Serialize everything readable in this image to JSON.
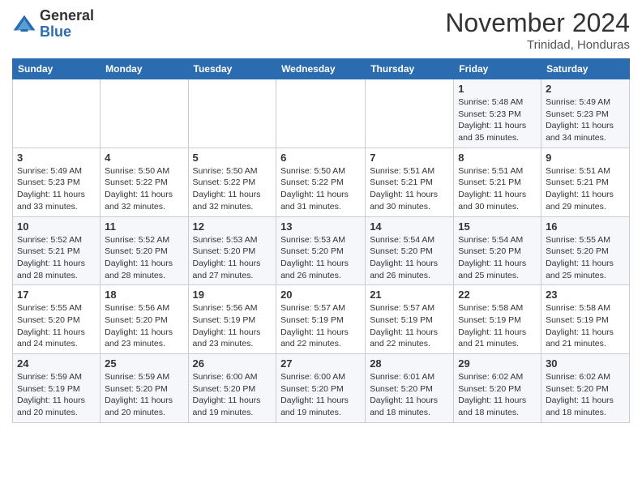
{
  "header": {
    "logo_general": "General",
    "logo_blue": "Blue",
    "month": "November 2024",
    "location": "Trinidad, Honduras"
  },
  "weekdays": [
    "Sunday",
    "Monday",
    "Tuesday",
    "Wednesday",
    "Thursday",
    "Friday",
    "Saturday"
  ],
  "weeks": [
    [
      {
        "day": "",
        "info": ""
      },
      {
        "day": "",
        "info": ""
      },
      {
        "day": "",
        "info": ""
      },
      {
        "day": "",
        "info": ""
      },
      {
        "day": "",
        "info": ""
      },
      {
        "day": "1",
        "info": "Sunrise: 5:48 AM\nSunset: 5:23 PM\nDaylight: 11 hours\nand 35 minutes."
      },
      {
        "day": "2",
        "info": "Sunrise: 5:49 AM\nSunset: 5:23 PM\nDaylight: 11 hours\nand 34 minutes."
      }
    ],
    [
      {
        "day": "3",
        "info": "Sunrise: 5:49 AM\nSunset: 5:23 PM\nDaylight: 11 hours\nand 33 minutes."
      },
      {
        "day": "4",
        "info": "Sunrise: 5:50 AM\nSunset: 5:22 PM\nDaylight: 11 hours\nand 32 minutes."
      },
      {
        "day": "5",
        "info": "Sunrise: 5:50 AM\nSunset: 5:22 PM\nDaylight: 11 hours\nand 32 minutes."
      },
      {
        "day": "6",
        "info": "Sunrise: 5:50 AM\nSunset: 5:22 PM\nDaylight: 11 hours\nand 31 minutes."
      },
      {
        "day": "7",
        "info": "Sunrise: 5:51 AM\nSunset: 5:21 PM\nDaylight: 11 hours\nand 30 minutes."
      },
      {
        "day": "8",
        "info": "Sunrise: 5:51 AM\nSunset: 5:21 PM\nDaylight: 11 hours\nand 30 minutes."
      },
      {
        "day": "9",
        "info": "Sunrise: 5:51 AM\nSunset: 5:21 PM\nDaylight: 11 hours\nand 29 minutes."
      }
    ],
    [
      {
        "day": "10",
        "info": "Sunrise: 5:52 AM\nSunset: 5:21 PM\nDaylight: 11 hours\nand 28 minutes."
      },
      {
        "day": "11",
        "info": "Sunrise: 5:52 AM\nSunset: 5:20 PM\nDaylight: 11 hours\nand 28 minutes."
      },
      {
        "day": "12",
        "info": "Sunrise: 5:53 AM\nSunset: 5:20 PM\nDaylight: 11 hours\nand 27 minutes."
      },
      {
        "day": "13",
        "info": "Sunrise: 5:53 AM\nSunset: 5:20 PM\nDaylight: 11 hours\nand 26 minutes."
      },
      {
        "day": "14",
        "info": "Sunrise: 5:54 AM\nSunset: 5:20 PM\nDaylight: 11 hours\nand 26 minutes."
      },
      {
        "day": "15",
        "info": "Sunrise: 5:54 AM\nSunset: 5:20 PM\nDaylight: 11 hours\nand 25 minutes."
      },
      {
        "day": "16",
        "info": "Sunrise: 5:55 AM\nSunset: 5:20 PM\nDaylight: 11 hours\nand 25 minutes."
      }
    ],
    [
      {
        "day": "17",
        "info": "Sunrise: 5:55 AM\nSunset: 5:20 PM\nDaylight: 11 hours\nand 24 minutes."
      },
      {
        "day": "18",
        "info": "Sunrise: 5:56 AM\nSunset: 5:20 PM\nDaylight: 11 hours\nand 23 minutes."
      },
      {
        "day": "19",
        "info": "Sunrise: 5:56 AM\nSunset: 5:19 PM\nDaylight: 11 hours\nand 23 minutes."
      },
      {
        "day": "20",
        "info": "Sunrise: 5:57 AM\nSunset: 5:19 PM\nDaylight: 11 hours\nand 22 minutes."
      },
      {
        "day": "21",
        "info": "Sunrise: 5:57 AM\nSunset: 5:19 PM\nDaylight: 11 hours\nand 22 minutes."
      },
      {
        "day": "22",
        "info": "Sunrise: 5:58 AM\nSunset: 5:19 PM\nDaylight: 11 hours\nand 21 minutes."
      },
      {
        "day": "23",
        "info": "Sunrise: 5:58 AM\nSunset: 5:19 PM\nDaylight: 11 hours\nand 21 minutes."
      }
    ],
    [
      {
        "day": "24",
        "info": "Sunrise: 5:59 AM\nSunset: 5:19 PM\nDaylight: 11 hours\nand 20 minutes."
      },
      {
        "day": "25",
        "info": "Sunrise: 5:59 AM\nSunset: 5:20 PM\nDaylight: 11 hours\nand 20 minutes."
      },
      {
        "day": "26",
        "info": "Sunrise: 6:00 AM\nSunset: 5:20 PM\nDaylight: 11 hours\nand 19 minutes."
      },
      {
        "day": "27",
        "info": "Sunrise: 6:00 AM\nSunset: 5:20 PM\nDaylight: 11 hours\nand 19 minutes."
      },
      {
        "day": "28",
        "info": "Sunrise: 6:01 AM\nSunset: 5:20 PM\nDaylight: 11 hours\nand 18 minutes."
      },
      {
        "day": "29",
        "info": "Sunrise: 6:02 AM\nSunset: 5:20 PM\nDaylight: 11 hours\nand 18 minutes."
      },
      {
        "day": "30",
        "info": "Sunrise: 6:02 AM\nSunset: 5:20 PM\nDaylight: 11 hours\nand 18 minutes."
      }
    ]
  ]
}
